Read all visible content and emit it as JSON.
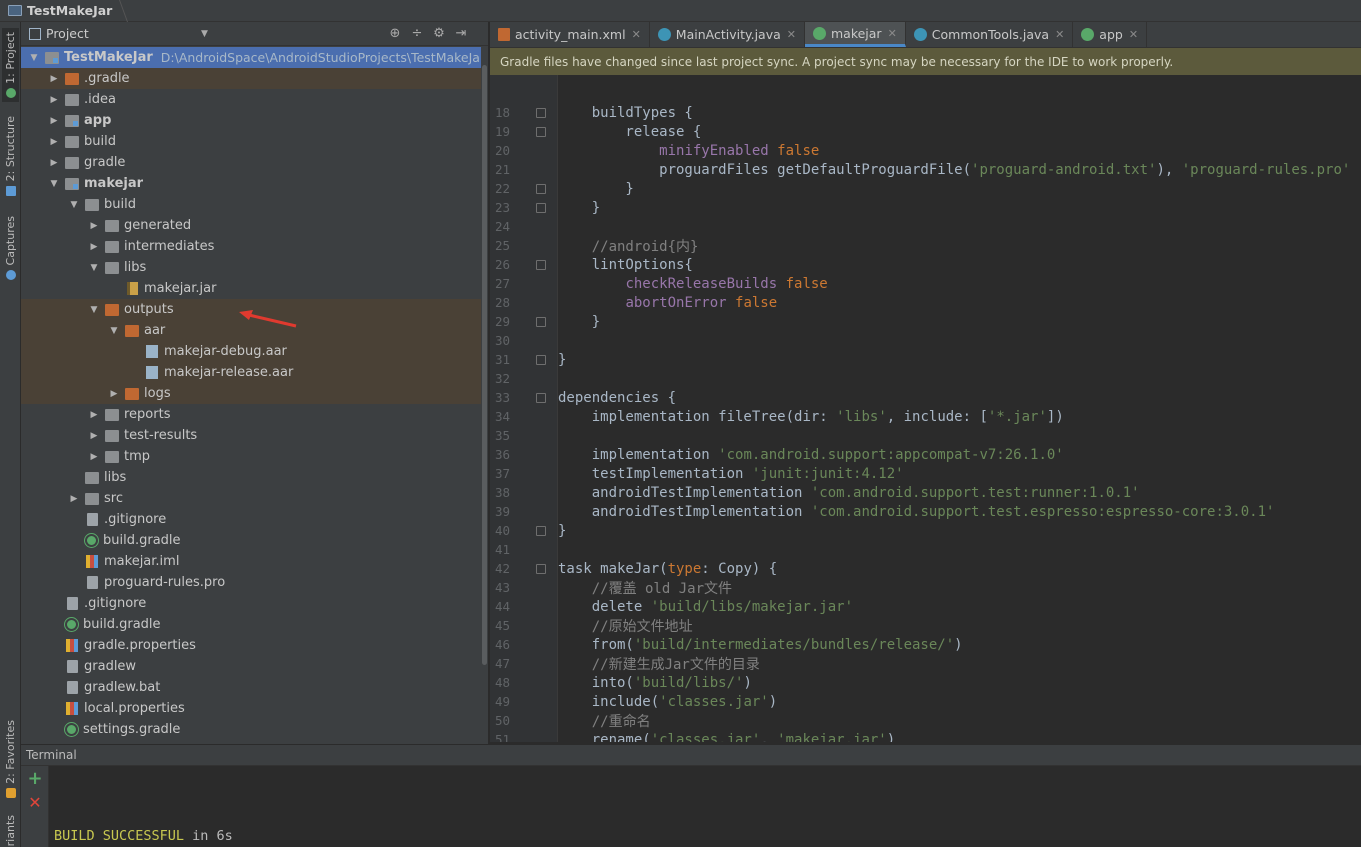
{
  "navbar": {
    "breadcrumb": "TestMakeJar"
  },
  "left_strip": {
    "tabs": [
      {
        "label": "1: Project"
      },
      {
        "label": "2: Structure"
      },
      {
        "label": "Captures"
      },
      {
        "label": "2: Favorites"
      },
      {
        "label": "riants"
      }
    ]
  },
  "project_panel": {
    "view_label": "Project",
    "tree": [
      {
        "label": "TestMakeJar",
        "path": "D:\\AndroidSpace\\AndroidStudioProjects\\TestMakeJar",
        "depth": 0,
        "arrow": "▼",
        "icon": "module",
        "bold": true,
        "state": "selected"
      },
      {
        "label": ".gradle",
        "depth": 1,
        "arrow": "▶",
        "icon": "folder-orange",
        "state": "highlight"
      },
      {
        "label": ".idea",
        "depth": 1,
        "arrow": "▶",
        "icon": "folder"
      },
      {
        "label": "app",
        "depth": 1,
        "arrow": "▶",
        "icon": "module",
        "bold": true
      },
      {
        "label": "build",
        "depth": 1,
        "arrow": "▶",
        "icon": "folder"
      },
      {
        "label": "gradle",
        "depth": 1,
        "arrow": "▶",
        "icon": "folder"
      },
      {
        "label": "makejar",
        "depth": 1,
        "arrow": "▼",
        "icon": "module",
        "bold": true
      },
      {
        "label": "build",
        "depth": 2,
        "arrow": "▼",
        "icon": "folder"
      },
      {
        "label": "generated",
        "depth": 3,
        "arrow": "▶",
        "icon": "folder"
      },
      {
        "label": "intermediates",
        "depth": 3,
        "arrow": "▶",
        "icon": "folder"
      },
      {
        "label": "libs",
        "depth": 3,
        "arrow": "▼",
        "icon": "folder"
      },
      {
        "label": "makejar.jar",
        "depth": 4,
        "arrow": "",
        "icon": "jar"
      },
      {
        "label": "outputs",
        "depth": 3,
        "arrow": "▼",
        "icon": "folder-orange",
        "state": "highlight"
      },
      {
        "label": "aar",
        "depth": 4,
        "arrow": "▼",
        "icon": "folder-orange",
        "state": "highlight"
      },
      {
        "label": "makejar-debug.aar",
        "depth": 5,
        "arrow": "",
        "icon": "aar",
        "state": "highlight"
      },
      {
        "label": "makejar-release.aar",
        "depth": 5,
        "arrow": "",
        "icon": "aar",
        "state": "highlight"
      },
      {
        "label": "logs",
        "depth": 4,
        "arrow": "▶",
        "icon": "folder-orange",
        "state": "highlight"
      },
      {
        "label": "reports",
        "depth": 3,
        "arrow": "▶",
        "icon": "folder"
      },
      {
        "label": "test-results",
        "depth": 3,
        "arrow": "▶",
        "icon": "folder"
      },
      {
        "label": "tmp",
        "depth": 3,
        "arrow": "▶",
        "icon": "folder"
      },
      {
        "label": "libs",
        "depth": 2,
        "arrow": "",
        "icon": "folder"
      },
      {
        "label": "src",
        "depth": 2,
        "arrow": "▶",
        "icon": "folder"
      },
      {
        "label": ".gitignore",
        "depth": 2,
        "arrow": "",
        "icon": "file"
      },
      {
        "label": "build.gradle",
        "depth": 2,
        "arrow": "",
        "icon": "gradle"
      },
      {
        "label": "makejar.iml",
        "depth": 2,
        "arrow": "",
        "icon": "props"
      },
      {
        "label": "proguard-rules.pro",
        "depth": 2,
        "arrow": "",
        "icon": "file"
      },
      {
        "label": ".gitignore",
        "depth": 1,
        "arrow": "",
        "icon": "file"
      },
      {
        "label": "build.gradle",
        "depth": 1,
        "arrow": "",
        "icon": "gradle"
      },
      {
        "label": "gradle.properties",
        "depth": 1,
        "arrow": "",
        "icon": "props"
      },
      {
        "label": "gradlew",
        "depth": 1,
        "arrow": "",
        "icon": "file"
      },
      {
        "label": "gradlew.bat",
        "depth": 1,
        "arrow": "",
        "icon": "file"
      },
      {
        "label": "local.properties",
        "depth": 1,
        "arrow": "",
        "icon": "props"
      },
      {
        "label": "settings.gradle",
        "depth": 1,
        "arrow": "",
        "icon": "gradle"
      }
    ]
  },
  "editor_tabs": [
    {
      "label": "activity_main.xml",
      "icon": "xml"
    },
    {
      "label": "MainActivity.java",
      "icon": "java"
    },
    {
      "label": "makejar",
      "icon": "gr",
      "active": true
    },
    {
      "label": "CommonTools.java",
      "icon": "java"
    },
    {
      "label": "app",
      "icon": "gr"
    }
  ],
  "notice": {
    "text": "Gradle files have changed since last project sync. A project sync may be necessary for the IDE to work properly."
  },
  "code": [
    {
      "n": "18",
      "fold": true,
      "segs": [
        [
          "",
          "    buildTypes {"
        ]
      ]
    },
    {
      "n": "19",
      "fold": true,
      "segs": [
        [
          "",
          "        release {"
        ]
      ]
    },
    {
      "n": "20",
      "segs": [
        [
          "",
          "            "
        ],
        [
          "prop",
          "minifyEnabled "
        ],
        [
          "kw",
          "false"
        ]
      ]
    },
    {
      "n": "21",
      "segs": [
        [
          "",
          "            proguardFiles getDefaultProguardFile("
        ],
        [
          "str",
          "'proguard-android.txt'"
        ],
        [
          "",
          "), "
        ],
        [
          "str",
          "'proguard-rules.pro'"
        ]
      ]
    },
    {
      "n": "22",
      "fold": true,
      "segs": [
        [
          "",
          "        }"
        ]
      ]
    },
    {
      "n": "23",
      "fold": true,
      "segs": [
        [
          "",
          "    }"
        ]
      ]
    },
    {
      "n": "24",
      "segs": [
        [
          "",
          ""
        ]
      ]
    },
    {
      "n": "25",
      "segs": [
        [
          "cmt",
          "    //android{内}"
        ]
      ]
    },
    {
      "n": "26",
      "fold": true,
      "segs": [
        [
          "",
          "    lintOptions{"
        ]
      ]
    },
    {
      "n": "27",
      "segs": [
        [
          "",
          "        "
        ],
        [
          "prop",
          "checkReleaseBuilds "
        ],
        [
          "kw",
          "false"
        ]
      ]
    },
    {
      "n": "28",
      "segs": [
        [
          "",
          "        "
        ],
        [
          "prop",
          "abortOnError "
        ],
        [
          "kw",
          "false"
        ]
      ]
    },
    {
      "n": "29",
      "fold": true,
      "segs": [
        [
          "",
          "    }"
        ]
      ]
    },
    {
      "n": "30",
      "segs": [
        [
          "",
          ""
        ]
      ]
    },
    {
      "n": "31",
      "fold": true,
      "segs": [
        [
          "",
          "}"
        ]
      ]
    },
    {
      "n": "32",
      "segs": [
        [
          "",
          ""
        ]
      ]
    },
    {
      "n": "33",
      "fold": true,
      "segs": [
        [
          "",
          "dependencies {"
        ]
      ]
    },
    {
      "n": "34",
      "segs": [
        [
          "",
          "    implementation fileTree("
        ],
        [
          "",
          "dir: "
        ],
        [
          "str",
          "'libs'"
        ],
        [
          "",
          ", "
        ],
        [
          "",
          "include: "
        ],
        [
          "",
          "["
        ],
        [
          "str",
          "'*.jar'"
        ],
        [
          "",
          "])"
        ]
      ]
    },
    {
      "n": "35",
      "segs": [
        [
          "",
          ""
        ]
      ]
    },
    {
      "n": "36",
      "segs": [
        [
          "",
          "    implementation "
        ],
        [
          "str",
          "'com.android.support:appcompat-v7:26.1.0'"
        ]
      ]
    },
    {
      "n": "37",
      "segs": [
        [
          "",
          "    testImplementation "
        ],
        [
          "str",
          "'junit:junit:4.12'"
        ]
      ]
    },
    {
      "n": "38",
      "segs": [
        [
          "",
          "    androidTestImplementation "
        ],
        [
          "str",
          "'com.android.support.test:runner:1.0.1'"
        ]
      ]
    },
    {
      "n": "39",
      "segs": [
        [
          "",
          "    androidTestImplementation "
        ],
        [
          "str",
          "'com.android.support.test.espresso:espresso-core:3.0.1'"
        ]
      ]
    },
    {
      "n": "40",
      "fold": true,
      "segs": [
        [
          "",
          "}"
        ]
      ]
    },
    {
      "n": "41",
      "segs": [
        [
          "",
          ""
        ]
      ]
    },
    {
      "n": "42",
      "fold": true,
      "segs": [
        [
          "",
          "task makeJar("
        ],
        [
          "kw",
          "type"
        ],
        [
          "",
          ": Copy) {"
        ]
      ]
    },
    {
      "n": "43",
      "segs": [
        [
          "cmt",
          "    //覆盖 old Jar文件"
        ]
      ]
    },
    {
      "n": "44",
      "segs": [
        [
          "",
          "    delete "
        ],
        [
          "str",
          "'build/libs/makejar.jar'"
        ]
      ]
    },
    {
      "n": "45",
      "segs": [
        [
          "cmt",
          "    //原始文件地址"
        ]
      ]
    },
    {
      "n": "46",
      "segs": [
        [
          "",
          "    from("
        ],
        [
          "str",
          "'build/intermediates/bundles/release/'"
        ],
        [
          "",
          ")"
        ]
      ]
    },
    {
      "n": "47",
      "segs": [
        [
          "cmt",
          "    //新建生成Jar文件的目录"
        ]
      ]
    },
    {
      "n": "48",
      "segs": [
        [
          "",
          "    into("
        ],
        [
          "str",
          "'build/libs/'"
        ],
        [
          "",
          ")"
        ]
      ]
    },
    {
      "n": "49",
      "segs": [
        [
          "",
          "    include("
        ],
        [
          "str",
          "'classes.jar'"
        ],
        [
          "",
          ")"
        ]
      ]
    },
    {
      "n": "50",
      "segs": [
        [
          "cmt",
          "    //重命名"
        ]
      ]
    },
    {
      "n": "51",
      "segs": [
        [
          "",
          "    rename("
        ],
        [
          "str",
          "'classes.jar'"
        ],
        [
          "",
          ", "
        ],
        [
          "str",
          "'makejar.jar'"
        ],
        [
          "",
          ")"
        ]
      ]
    }
  ],
  "terminal": {
    "title": "Terminal",
    "add_label": "+",
    "close_label": "✕",
    "success": "BUILD SUCCESSFUL",
    "rest": " in 6s"
  }
}
